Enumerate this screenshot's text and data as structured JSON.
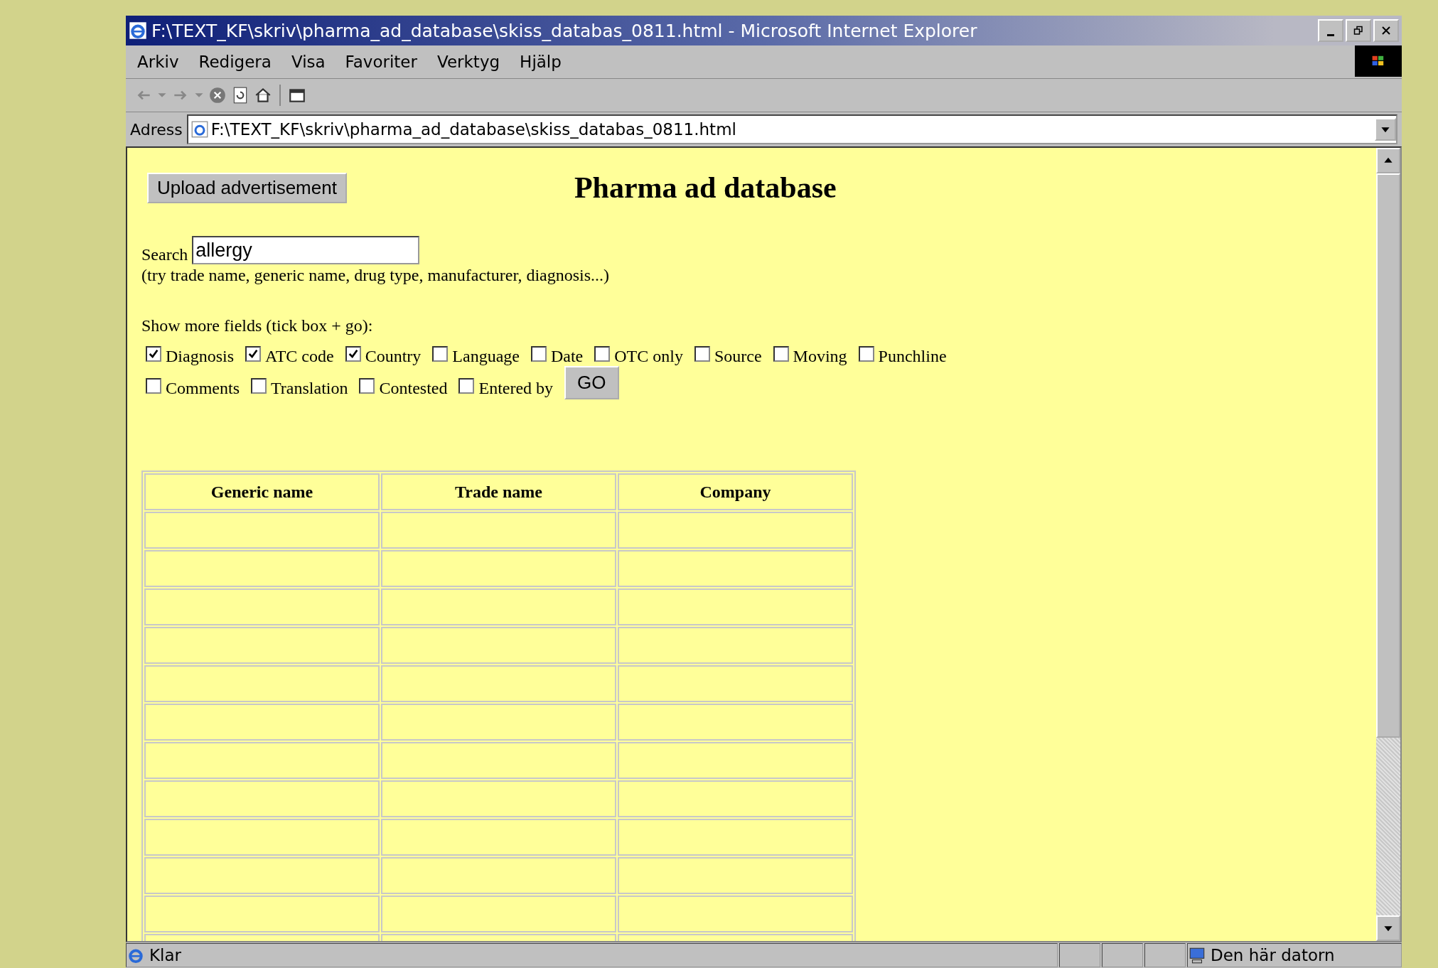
{
  "window": {
    "title": "F:\\TEXT_KF\\skriv\\pharma_ad_database\\skiss_databas_0811.html - Microsoft Internet Explorer"
  },
  "menu": [
    "Arkiv",
    "Redigera",
    "Visa",
    "Favoriter",
    "Verktyg",
    "Hjälp"
  ],
  "address": {
    "label": "Adress",
    "value": "F:\\TEXT_KF\\skriv\\pharma_ad_database\\skiss_databas_0811.html"
  },
  "page": {
    "upload_button": "Upload advertisement",
    "heading": "Pharma ad database",
    "search": {
      "label": "Search",
      "value": "allergy",
      "hint": "(try trade name, generic name, drug type, manufacturer, diagnosis...)"
    },
    "fields_label": "Show more fields (tick box + go):",
    "field_rows": [
      [
        {
          "label": "Diagnosis",
          "checked": true
        },
        {
          "label": "ATC code",
          "checked": true
        },
        {
          "label": "Country",
          "checked": true
        },
        {
          "label": "Language",
          "checked": false
        },
        {
          "label": "Date",
          "checked": false
        },
        {
          "label": "OTC only",
          "checked": false
        },
        {
          "label": "Source",
          "checked": false
        },
        {
          "label": "Moving",
          "checked": false
        },
        {
          "label": "Punchline",
          "checked": false
        }
      ],
      [
        {
          "label": "Comments",
          "checked": false
        },
        {
          "label": "Translation",
          "checked": false
        },
        {
          "label": "Contested",
          "checked": false
        },
        {
          "label": "Entered by",
          "checked": false
        }
      ]
    ],
    "go_button": "GO",
    "table": {
      "columns": [
        "Generic name",
        "Trade name",
        "Company"
      ]
    }
  },
  "status_bar": {
    "status": "Klar",
    "zone": "Den här datorn"
  }
}
